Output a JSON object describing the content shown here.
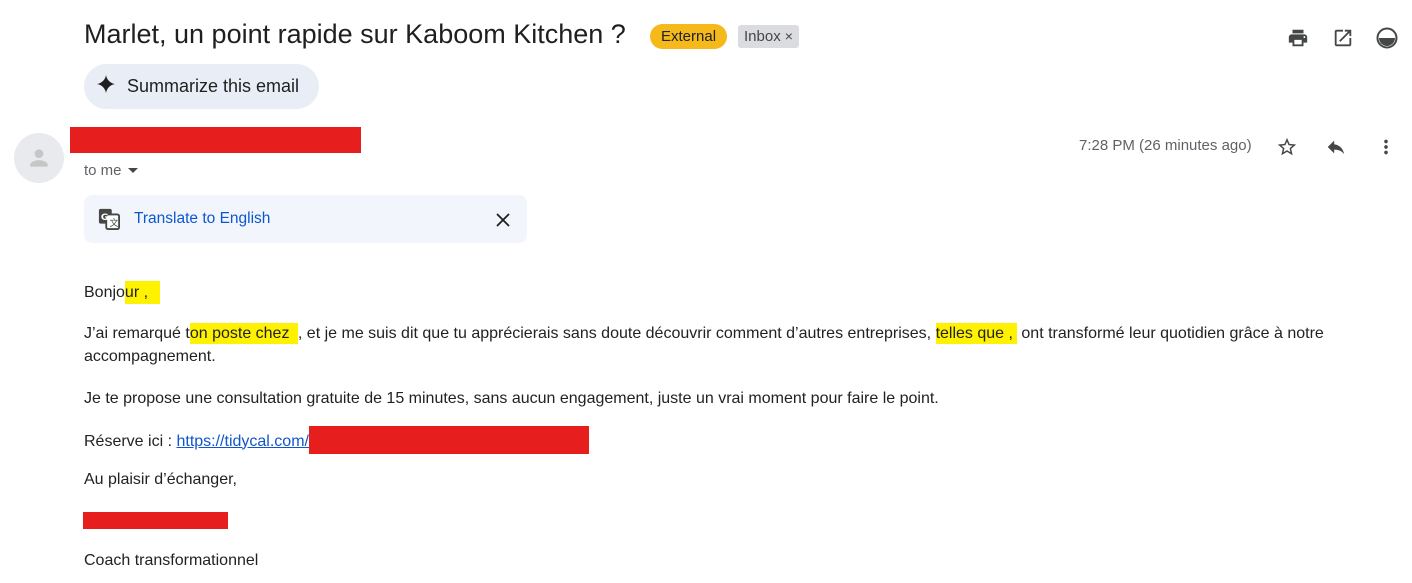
{
  "header": {
    "subject": "Marlet, un point rapide sur Kaboom Kitchen ?",
    "badge_external": "External",
    "badge_inbox": "Inbox",
    "badge_inbox_remove": "×",
    "icons": [
      "print-icon",
      "open-in-new-window-icon",
      "theme-toggle-icon"
    ]
  },
  "summarize": {
    "label": "Summarize this email",
    "icon": "sparkle-icon"
  },
  "message": {
    "to": "to me",
    "timestamp": "7:28 PM (26 minutes ago)",
    "icons": [
      "star-icon",
      "reply-icon",
      "more-vert-icon"
    ]
  },
  "translate": {
    "label": "Translate to English",
    "icon": "translate-icon",
    "close_icon": "close-icon"
  },
  "body": {
    "greeting_prefix": "Bonjo",
    "greeting_highlight": "ur ,",
    "p1_a": "J’ai remarqué t",
    "p1_hl1": "on poste chez ",
    "p1_b": ", et je me suis dit que tu apprécierais sans doute découvrir comment d’autres entreprises,",
    "p1_hl2": "telles que ,",
    "p1_c": "ont transformé leur quotidien grâce à notre",
    "p1_d": "accompagnement.",
    "p2": "Je te propose une consultation gratuite de 15 minutes, sans aucun engagement, juste un vrai moment pour faire le point.",
    "p3_label": "Réserve ici : ",
    "p3_link": "https://tidycal.com/",
    "p4": "Au plaisir d’échanger,",
    "p5": "Coach transformationnel"
  },
  "colors": {
    "external_badge": "#f6b91c",
    "highlight": "#fff200",
    "redaction": "#e61e1e",
    "link": "#1155cc"
  }
}
